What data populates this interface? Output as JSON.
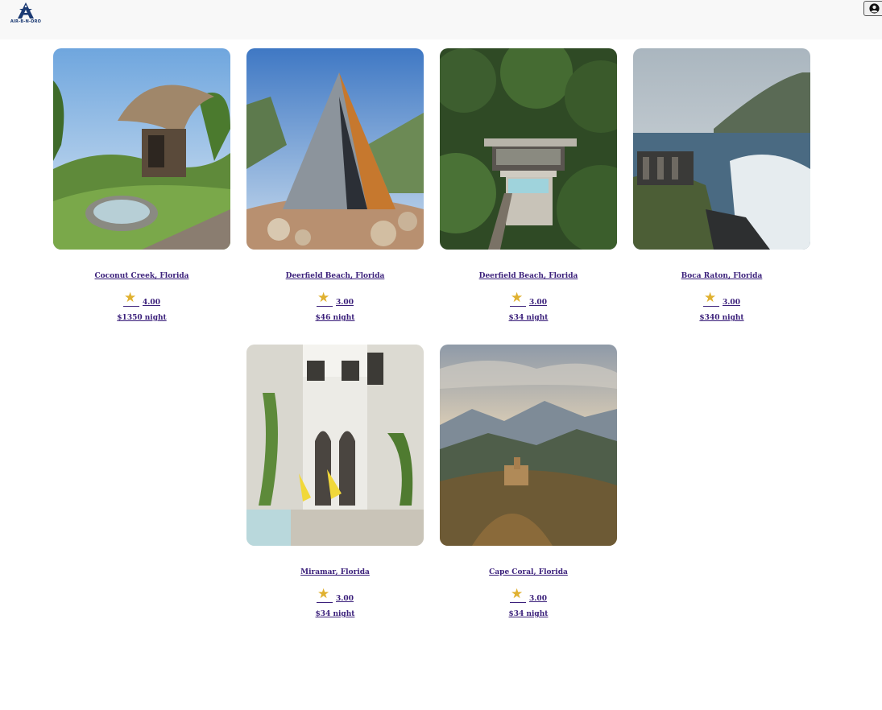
{
  "header": {
    "logo_text": "AIR-B-N-DRO"
  },
  "listings": [
    {
      "location": "Coconut Creek, Florida",
      "rating": "4.00",
      "price": "$1350 night"
    },
    {
      "location": "Deerfield Beach, Florida",
      "rating": "3.00",
      "price": "$46 night"
    },
    {
      "location": "Deerfield Beach, Florida",
      "rating": "3.00",
      "price": "$34 night"
    },
    {
      "location": "Boca Raton, Florida",
      "rating": "3.00",
      "price": "$340 night"
    },
    {
      "location": "Miramar, Florida",
      "rating": "3.00",
      "price": "$34 night"
    },
    {
      "location": "Cape Coral, Florida",
      "rating": "3.00",
      "price": "$34 night"
    }
  ],
  "colors": {
    "link": "#3a1f7a",
    "star": "#e0b130",
    "header_bg": "#f8f8f8",
    "logo": "#1b3a73"
  }
}
